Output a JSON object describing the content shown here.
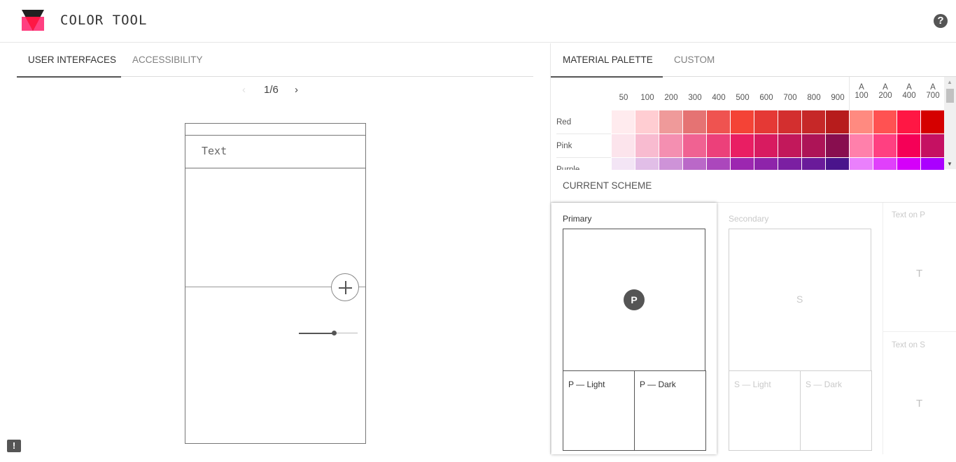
{
  "header": {
    "title": "COLOR TOOL",
    "help_icon_glyph": "?",
    "logo_colors": {
      "top": "#212121",
      "bottom": "#ff4081",
      "triangle": "#ff1744"
    }
  },
  "left_panel": {
    "tabs": [
      {
        "label": "USER INTERFACES",
        "active": true
      },
      {
        "label": "ACCESSIBILITY",
        "active": false
      }
    ],
    "pager": {
      "prev": "‹",
      "label": "1/6",
      "next": "›"
    },
    "mockup": {
      "text_field_label": "Text",
      "slider_value_fraction": 0.6
    },
    "feedback_icon_glyph": "!"
  },
  "right_panel": {
    "tabs": [
      {
        "label": "MATERIAL PALETTE",
        "active": true
      },
      {
        "label": "CUSTOM",
        "active": false
      }
    ],
    "palette": {
      "columns": [
        {
          "top": "",
          "bottom": "50"
        },
        {
          "top": "",
          "bottom": "100"
        },
        {
          "top": "",
          "bottom": "200"
        },
        {
          "top": "",
          "bottom": "300"
        },
        {
          "top": "",
          "bottom": "400"
        },
        {
          "top": "",
          "bottom": "500"
        },
        {
          "top": "",
          "bottom": "600"
        },
        {
          "top": "",
          "bottom": "700"
        },
        {
          "top": "",
          "bottom": "800"
        },
        {
          "top": "",
          "bottom": "900"
        },
        {
          "top": "A",
          "bottom": "100"
        },
        {
          "top": "A",
          "bottom": "200"
        },
        {
          "top": "A",
          "bottom": "400"
        },
        {
          "top": "A",
          "bottom": "700"
        }
      ],
      "rows": [
        {
          "name": "Red",
          "colors": [
            "#ffebee",
            "#ffcdd2",
            "#ef9a9a",
            "#e57373",
            "#ef5350",
            "#f44336",
            "#e53935",
            "#d32f2f",
            "#c62828",
            "#b71c1c",
            "#ff8a80",
            "#ff5252",
            "#ff1744",
            "#d50000"
          ]
        },
        {
          "name": "Pink",
          "colors": [
            "#fce4ec",
            "#f8bbd0",
            "#f48fb1",
            "#f06292",
            "#ec407a",
            "#e91e63",
            "#d81b60",
            "#c2185b",
            "#ad1457",
            "#880e4f",
            "#ff80ab",
            "#ff4081",
            "#f50057",
            "#c51162"
          ]
        },
        {
          "name": "Purple",
          "colors": [
            "#f3e5f5",
            "#e1bee7",
            "#ce93d8",
            "#ba68c8",
            "#ab47bc",
            "#9c27b0",
            "#8e24aa",
            "#7b1fa2",
            "#6a1b9a",
            "#4a148c",
            "#ea80fc",
            "#e040fb",
            "#d500f9",
            "#aa00ff"
          ]
        }
      ]
    },
    "current_scheme": {
      "title": "CURRENT SCHEME",
      "primary": {
        "label": "Primary",
        "badge": "P",
        "light_label": "P — Light",
        "dark_label": "P — Dark"
      },
      "secondary": {
        "label": "Secondary",
        "badge": "S",
        "light_label": "S — Light",
        "dark_label": "S — Dark"
      },
      "text_on_p": {
        "label": "Text on P",
        "glyph": "T"
      },
      "text_on_s": {
        "label": "Text on S",
        "glyph": "T"
      }
    }
  }
}
